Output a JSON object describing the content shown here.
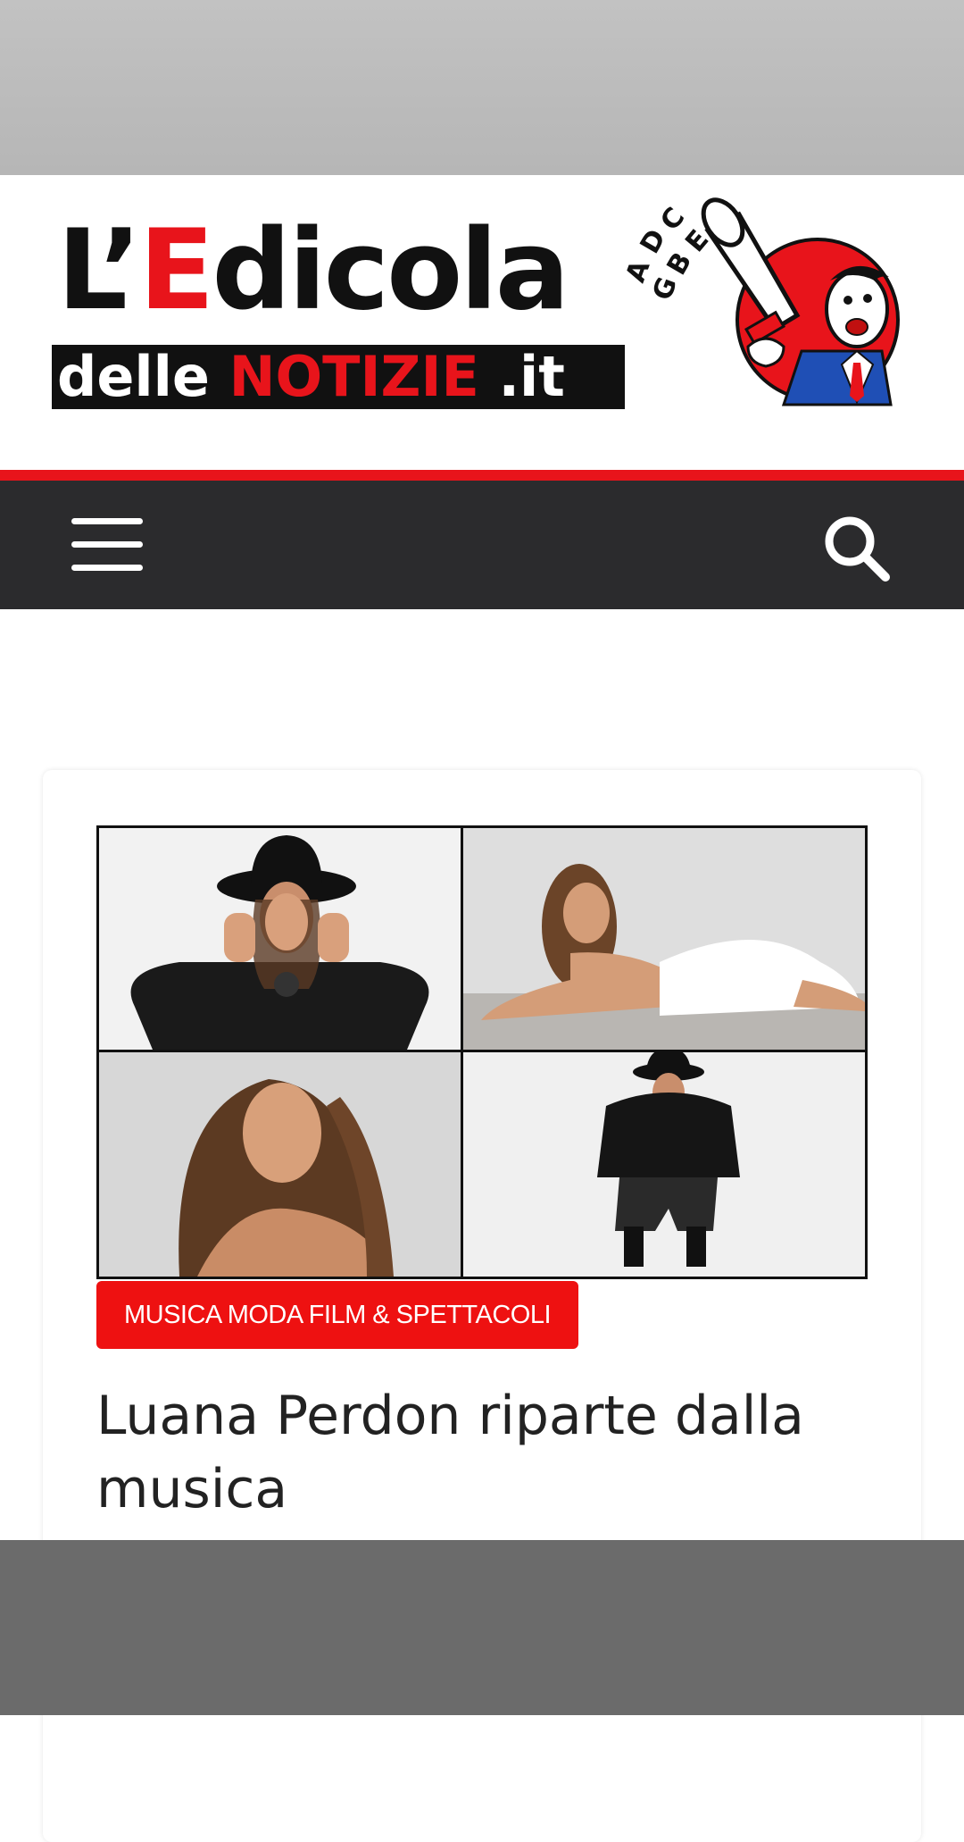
{
  "logo": {
    "line1_prefix": "L’",
    "line1_accent": "E",
    "line1_suffix": "dicola",
    "line2_prefix": "delle ",
    "line2_accent": "NOTIZIE",
    "line2_suffix": " .it",
    "mascot_letters": [
      "A",
      "D",
      "C",
      "G",
      "B",
      "E",
      "A"
    ]
  },
  "nav": {
    "menu_icon": "hamburger-menu-icon",
    "search_icon": "search-icon"
  },
  "article": {
    "category": "MUSICA MODA FILM & SPETTACOLI",
    "title": "Luana Perdon riparte dalla musica"
  },
  "colors": {
    "brand_red": "#e8141b",
    "navbar": "#2b2b2d",
    "badge_red": "#ee1111",
    "title": "#222222"
  }
}
